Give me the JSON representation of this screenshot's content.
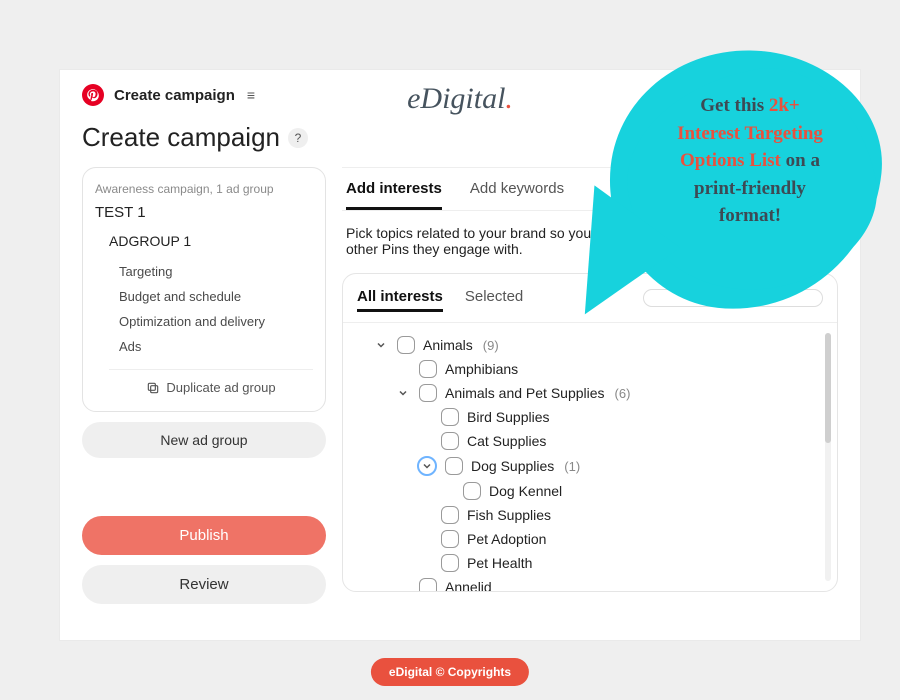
{
  "topbar": {
    "title": "Create campaign"
  },
  "brand": {
    "name_main": "eDigital",
    "name_dot": "."
  },
  "page": {
    "title": "Create campaign",
    "help": "?"
  },
  "sidebar": {
    "meta": "Awareness campaign, 1 ad group",
    "campaign_name": "TEST 1",
    "adgroup_name": "ADGROUP 1",
    "nav": [
      "Targeting",
      "Budget and schedule",
      "Optimization and delivery",
      "Ads"
    ],
    "duplicate_label": "Duplicate ad group",
    "new_adgroup_label": "New ad group"
  },
  "actions": {
    "publish": "Publish",
    "review": "Review"
  },
  "main": {
    "tabs": {
      "add_interests": "Add interests",
      "add_keywords": "Add keywords"
    },
    "description": "Pick topics related to your brand so you can reach people based on other Pins they engage with.",
    "panel_tabs": {
      "all": "All interests",
      "selected": "Selected"
    },
    "ghost_button": " "
  },
  "tree": {
    "animals": {
      "label": "Animals",
      "count": "(9)"
    },
    "amphibians": "Amphibians",
    "pet_supplies": {
      "label": "Animals and Pet Supplies",
      "count": "(6)"
    },
    "bird": "Bird Supplies",
    "cat": "Cat Supplies",
    "dog": {
      "label": "Dog Supplies",
      "count": "(1)"
    },
    "dog_kennel": "Dog Kennel",
    "fish": "Fish Supplies",
    "pet_adoption": "Pet Adoption",
    "pet_health": "Pet Health",
    "annelid": "Annelid"
  },
  "callout": {
    "line1_a": "Get this ",
    "line1_b": "2k+",
    "line2": "Interest Targeting",
    "line3_a": "Options List ",
    "line3_b": "on a",
    "line4": "print-friendly",
    "line5": "format!"
  },
  "footer": {
    "label": "eDigital © Copyrights"
  }
}
